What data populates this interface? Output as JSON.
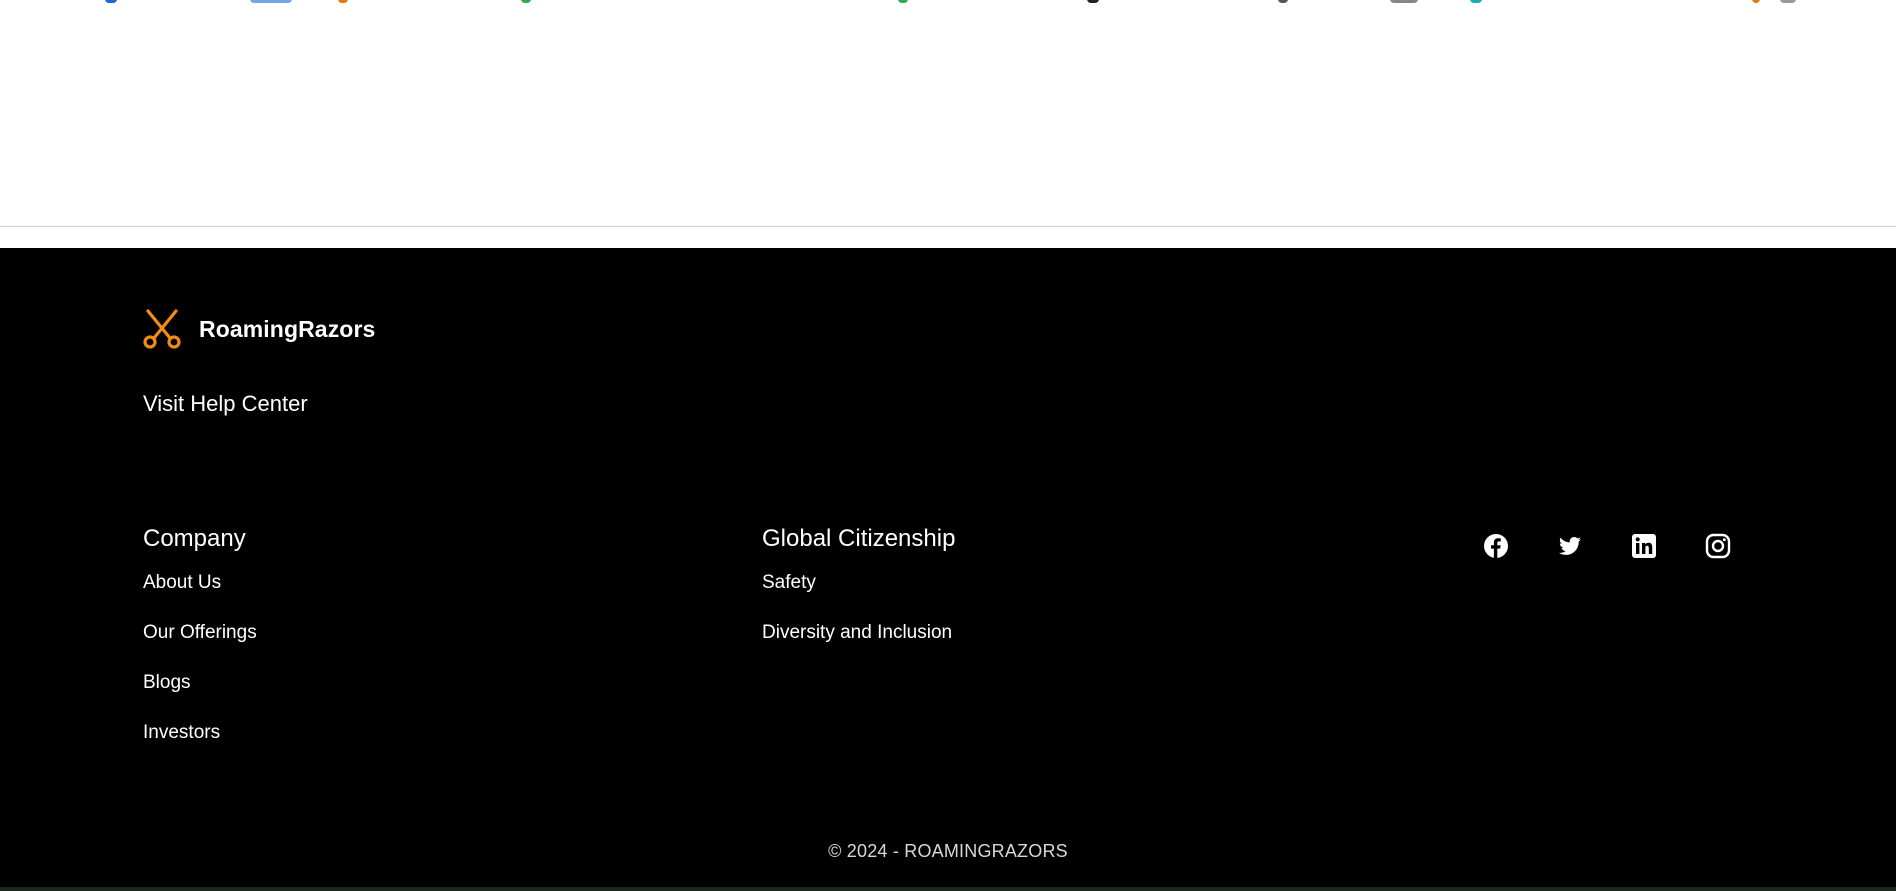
{
  "brand": {
    "name": "RoamingRazors",
    "logo_icon": "scissors-icon",
    "accent_color": "#f28c13"
  },
  "help": {
    "label": "Visit Help Center"
  },
  "columns": {
    "company": {
      "heading": "Company",
      "links": [
        "About Us",
        "Our Offerings",
        "Blogs",
        "Investors"
      ]
    },
    "global": {
      "heading": "Global Citizenship",
      "links": [
        "Safety",
        "Diversity and Inclusion"
      ]
    }
  },
  "socials": [
    {
      "name": "facebook",
      "icon": "facebook-icon"
    },
    {
      "name": "twitter",
      "icon": "twitter-icon"
    },
    {
      "name": "linkedin",
      "icon": "linkedin-icon"
    },
    {
      "name": "instagram",
      "icon": "instagram-icon"
    }
  ],
  "copyright": "© 2024 - ROAMINGRAZORS",
  "colors": {
    "footer_background": "#000000",
    "footer_text": "#ffffff",
    "page_background": "#ffffff"
  }
}
